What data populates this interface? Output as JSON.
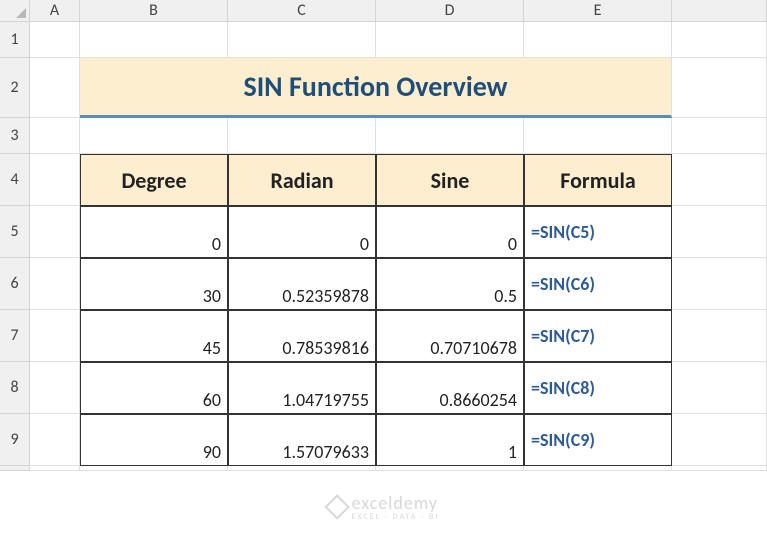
{
  "columns": [
    "A",
    "B",
    "C",
    "D",
    "E"
  ],
  "rows": [
    "1",
    "2",
    "3",
    "4",
    "5",
    "6",
    "7",
    "8",
    "9"
  ],
  "title": "SIN Function Overview",
  "headers": {
    "degree": "Degree",
    "radian": "Radian",
    "sine": "Sine",
    "formula": "Formula"
  },
  "data": [
    {
      "degree": "0",
      "radian": "0",
      "sine": "0",
      "formula": "=SIN(C5)"
    },
    {
      "degree": "30",
      "radian": "0.52359878",
      "sine": "0.5",
      "formula": "=SIN(C6)"
    },
    {
      "degree": "45",
      "radian": "0.78539816",
      "sine": "0.70710678",
      "formula": "=SIN(C7)"
    },
    {
      "degree": "60",
      "radian": "1.04719755",
      "sine": "0.8660254",
      "formula": "=SIN(C8)"
    },
    {
      "degree": "90",
      "radian": "1.57079633",
      "sine": "1",
      "formula": "=SIN(C9)"
    }
  ],
  "watermark": {
    "name": "exceldemy",
    "tagline": "EXCEL · DATA · BI"
  },
  "chart_data": {
    "type": "table",
    "title": "SIN Function Overview",
    "columns": [
      "Degree",
      "Radian",
      "Sine",
      "Formula"
    ],
    "rows": [
      [
        0,
        0,
        0,
        "=SIN(C5)"
      ],
      [
        30,
        0.52359878,
        0.5,
        "=SIN(C6)"
      ],
      [
        45,
        0.78539816,
        0.70710678,
        "=SIN(C7)"
      ],
      [
        60,
        1.04719755,
        0.8660254,
        "=SIN(C8)"
      ],
      [
        90,
        1.57079633,
        1,
        "=SIN(C9)"
      ]
    ]
  }
}
